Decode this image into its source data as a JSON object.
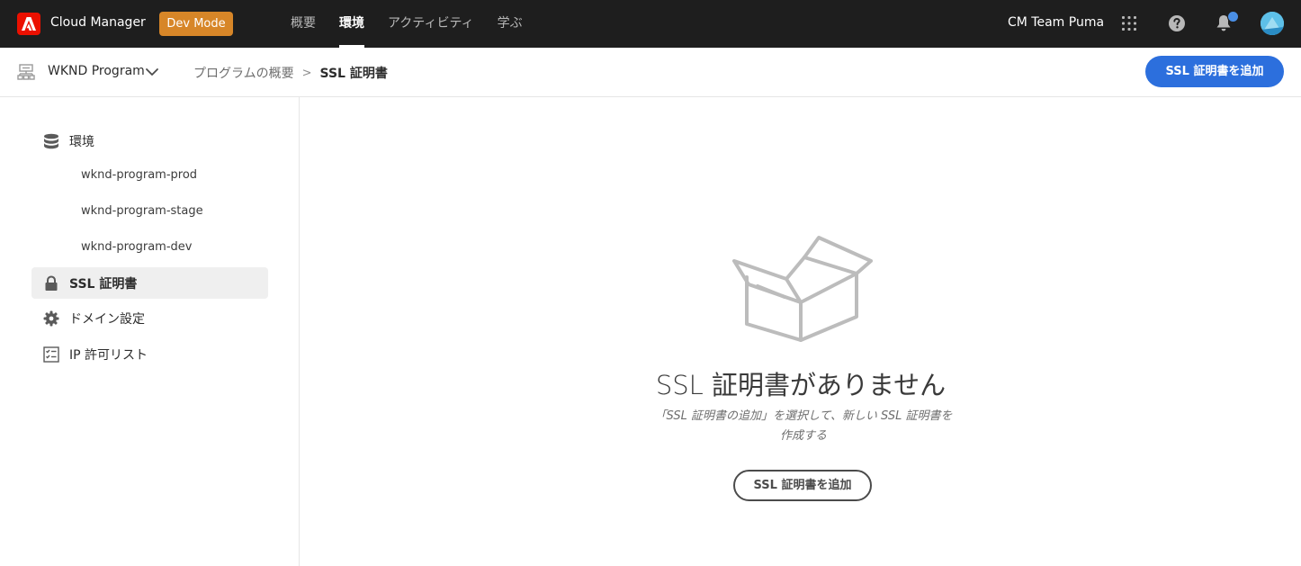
{
  "shell": {
    "app_name": "Cloud Manager",
    "dev_mode_label": "Dev Mode",
    "tabs": [
      {
        "label": "概要",
        "active": false
      },
      {
        "label": "環境",
        "active": true
      },
      {
        "label": "アクティビティ",
        "active": false
      },
      {
        "label": "学ぶ",
        "active": false
      }
    ],
    "org_name": "CM Team Puma",
    "icons": [
      "app-switcher-icon",
      "help-icon",
      "bell-icon",
      "user-avatar"
    ],
    "colors": {
      "shell_bg": "#1e1e1e",
      "adobe_red": "#eb1000",
      "dev_mode": "#d78628",
      "accent_blue": "#2c6fdd"
    }
  },
  "subheader": {
    "program_name": "WKND Program",
    "breadcrumb": {
      "parent": "プログラムの概要",
      "separator": ">",
      "current": "SSL 証明書"
    },
    "primary_action": "SSL 証明書を追加"
  },
  "rail": {
    "environments_label": "環境",
    "environments": [
      "wknd-program-prod",
      "wknd-program-stage",
      "wknd-program-dev"
    ],
    "ssl_label": "SSL 証明書",
    "domain_label": "ドメイン設定",
    "ip_label": "IP 許可リスト"
  },
  "empty_state": {
    "title": "SSL 証明書がありません",
    "description": "「SSL 証明書の追加」を選択して、新しい SSL 証明書を作成する",
    "button_label": "SSL 証明書を追加"
  }
}
